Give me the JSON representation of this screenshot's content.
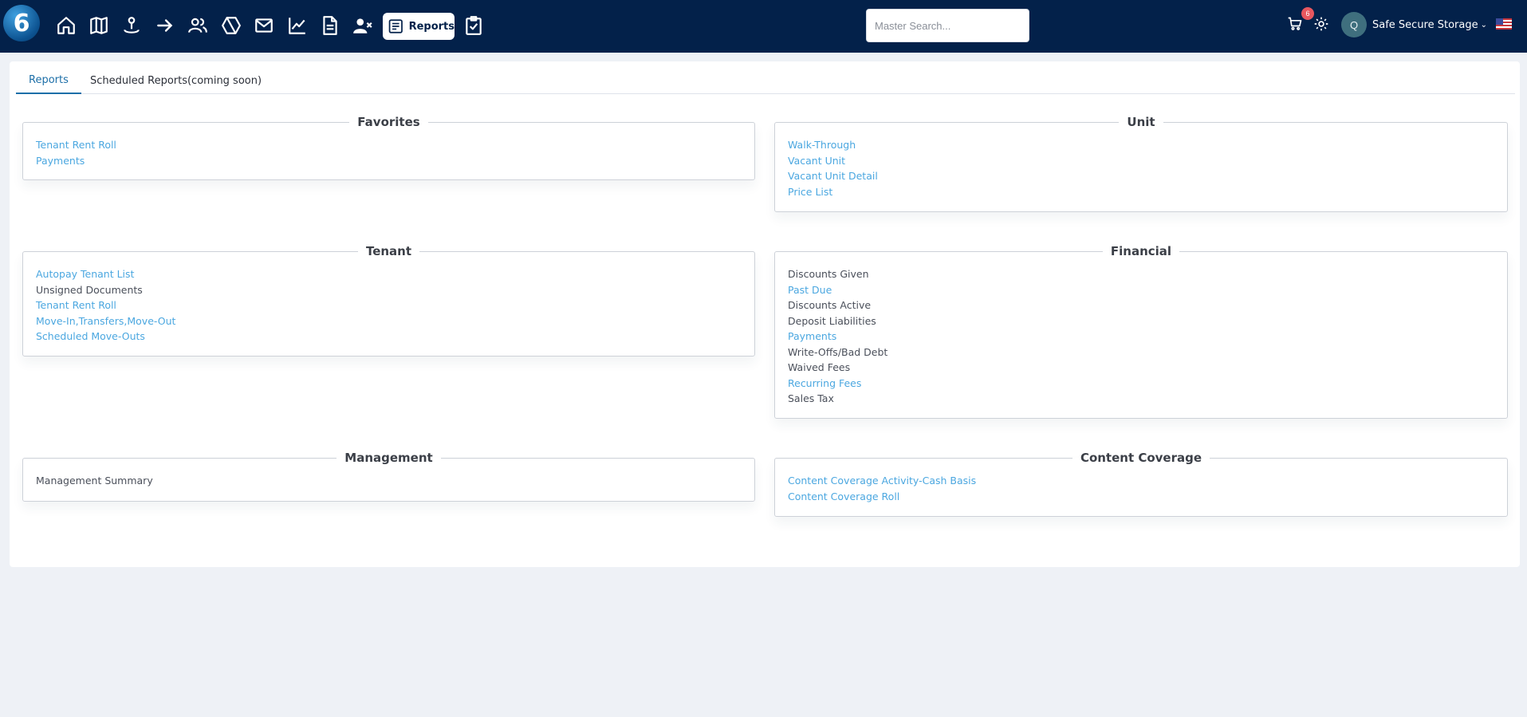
{
  "app": {
    "logo_text": "6",
    "reports_label": "Reports",
    "search_placeholder": "Master Search...",
    "cart_count": "6",
    "avatar_initial": "Q",
    "company_name": "Safe Secure Storage",
    "brand_color": "#03214a",
    "link_color": "#4ba7e0"
  },
  "nav_icons": [
    "home-icon",
    "map-icon",
    "person-pin-icon",
    "arrow-right-icon",
    "users-icon",
    "hexagon-icon",
    "mail-icon",
    "chart-line-icon",
    "document-icon",
    "user-remove-icon",
    "reports-icon",
    "clipboard-check-icon"
  ],
  "tabs": [
    {
      "label": "Reports",
      "active": true
    },
    {
      "label": "Scheduled Reports(coming soon)",
      "active": false
    }
  ],
  "groups": {
    "favorites": {
      "title": "Favorites",
      "items": [
        {
          "label": "Tenant Rent Roll",
          "link": true
        },
        {
          "label": "Payments",
          "link": true
        }
      ]
    },
    "unit": {
      "title": "Unit",
      "items": [
        {
          "label": "Walk-Through",
          "link": true
        },
        {
          "label": "Vacant Unit",
          "link": true
        },
        {
          "label": "Vacant Unit Detail",
          "link": true
        },
        {
          "label": "Price List",
          "link": true
        }
      ]
    },
    "tenant": {
      "title": "Tenant",
      "items": [
        {
          "label": "Autopay Tenant List",
          "link": true
        },
        {
          "label": "Unsigned Documents",
          "link": false
        },
        {
          "label": "Tenant Rent Roll",
          "link": true
        },
        {
          "label": "Move-In,Transfers,Move-Out",
          "link": true
        },
        {
          "label": "Scheduled Move-Outs",
          "link": true
        }
      ]
    },
    "financial": {
      "title": "Financial",
      "items": [
        {
          "label": "Discounts Given",
          "link": false
        },
        {
          "label": "Past Due",
          "link": true
        },
        {
          "label": "Discounts Active",
          "link": false
        },
        {
          "label": "Deposit Liabilities",
          "link": false
        },
        {
          "label": "Payments",
          "link": true
        },
        {
          "label": "Write-Offs/Bad Debt",
          "link": false
        },
        {
          "label": "Waived Fees",
          "link": false
        },
        {
          "label": "Recurring Fees",
          "link": true
        },
        {
          "label": "Sales Tax",
          "link": false
        }
      ]
    },
    "management": {
      "title": "Management",
      "items": [
        {
          "label": "Management Summary",
          "link": false
        }
      ]
    },
    "content_coverage": {
      "title": "Content Coverage",
      "items": [
        {
          "label": "Content Coverage Activity-Cash Basis",
          "link": true
        },
        {
          "label": "Content Coverage Roll",
          "link": true
        }
      ]
    }
  }
}
